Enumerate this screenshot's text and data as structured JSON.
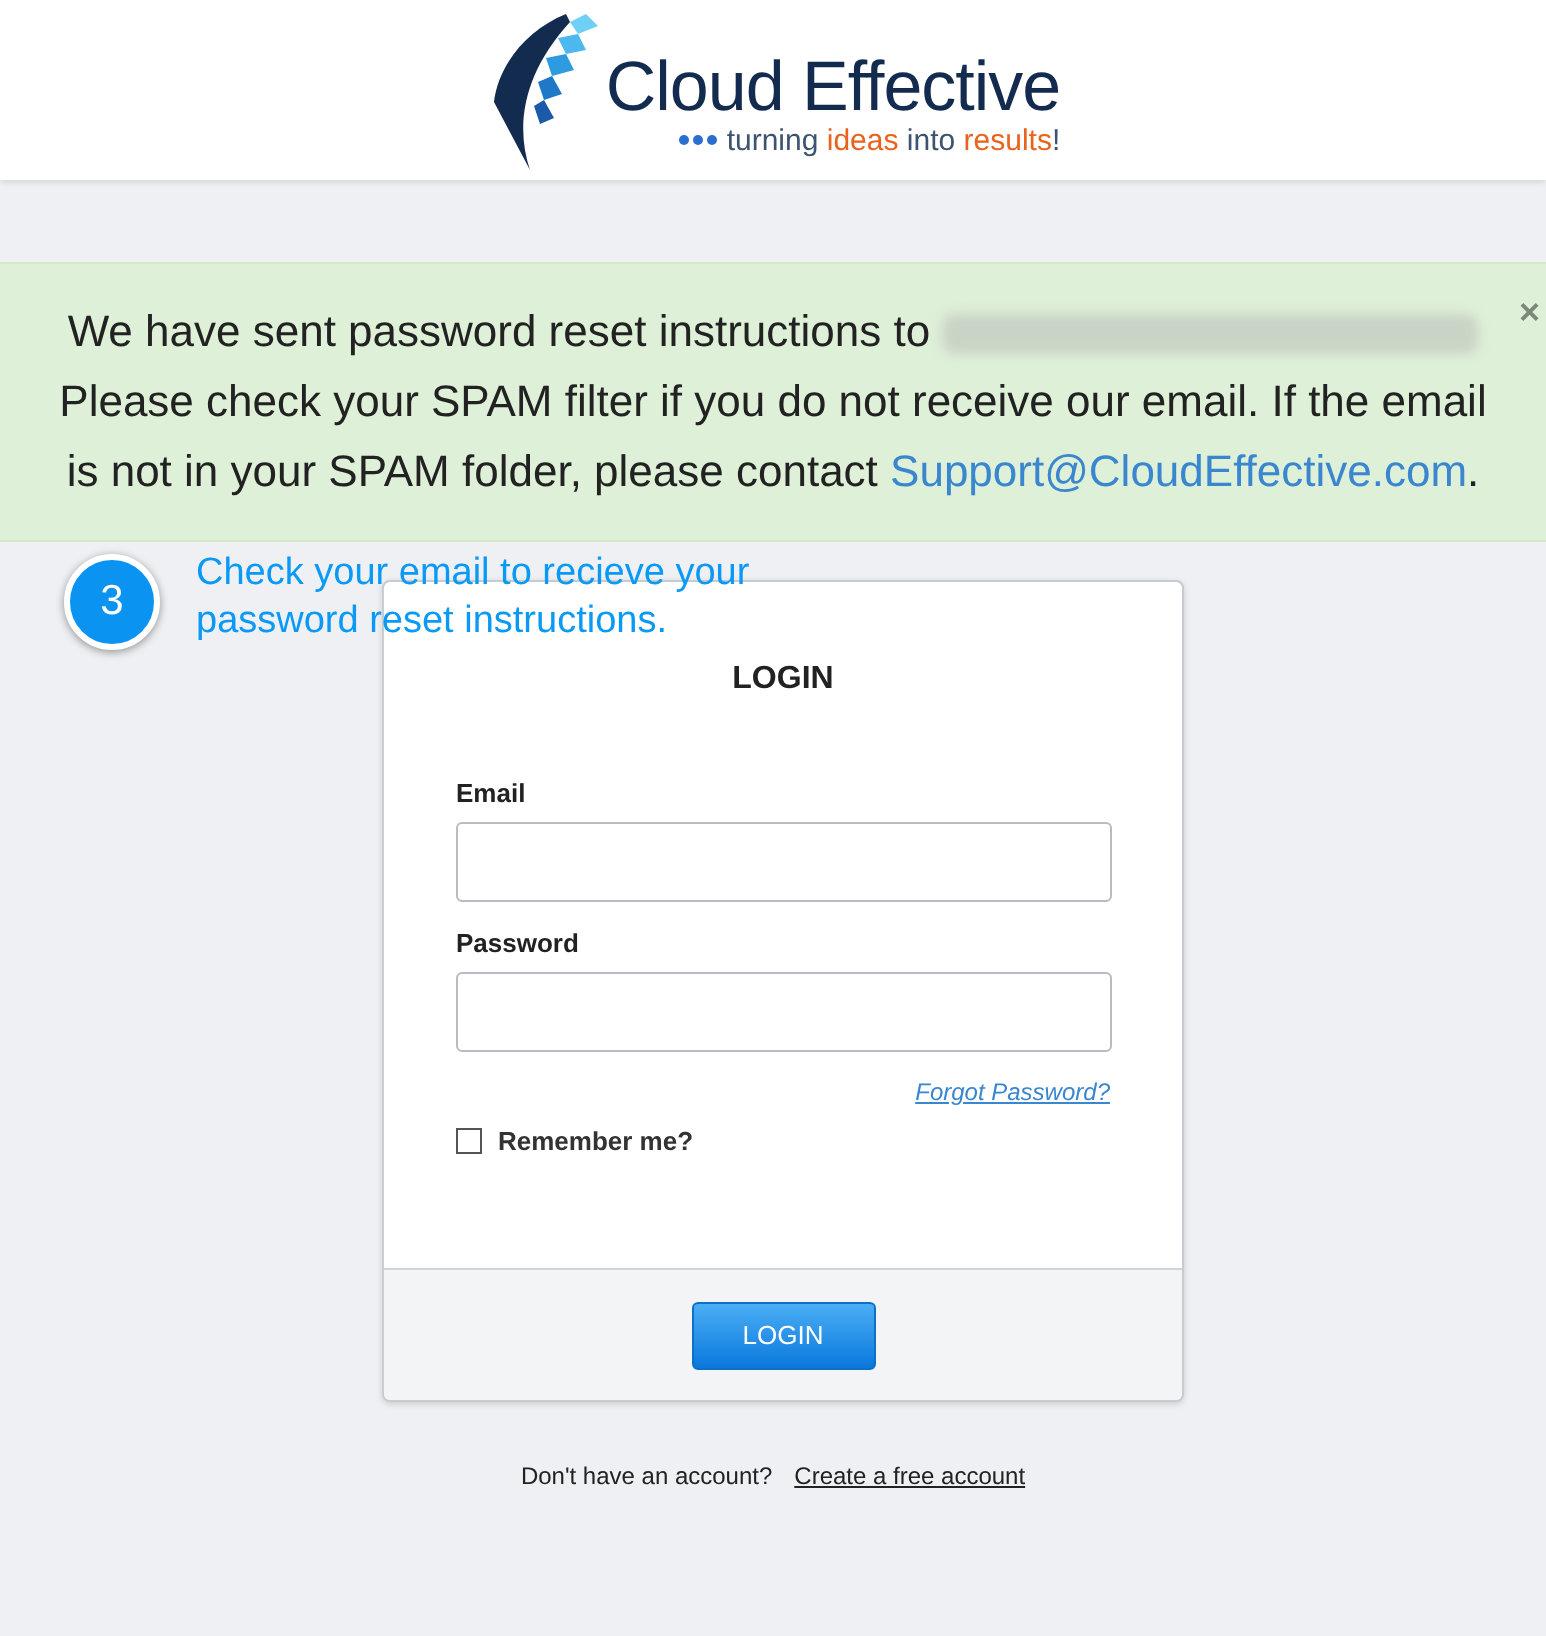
{
  "header": {
    "logo": {
      "name": "Cloud Effective",
      "tagline": [
        {
          "text": "turning ",
          "highlight": false
        },
        {
          "text": "ideas",
          "highlight": true
        },
        {
          "text": " into ",
          "highlight": false
        },
        {
          "text": "results",
          "highlight": true
        },
        {
          "text": "!",
          "highlight": false
        }
      ]
    }
  },
  "alert": {
    "close": "×",
    "parts": [
      {
        "kind": "text",
        "text": "We have sent password reset instructions to "
      },
      {
        "kind": "redacted"
      },
      {
        "kind": "text",
        "text": " Please check your SPAM filter if you do not receive our email. If the email is not in your SPAM folder, please contact "
      },
      {
        "kind": "link",
        "text": "Support@CloudEffective.com"
      },
      {
        "kind": "text",
        "text": "."
      }
    ]
  },
  "callout": {
    "step": "3",
    "text": "Check your email to recieve your password reset instructions."
  },
  "login": {
    "title": "LOGIN",
    "fields": [
      {
        "label": "Email"
      },
      {
        "label": "Password"
      }
    ],
    "forgot": "Forgot Password?",
    "remember": {
      "label": "Remember me?",
      "checked": false
    },
    "button": "LOGIN"
  },
  "footer": {
    "prompt": "Don't have an account?",
    "link": "Create a free account"
  }
}
